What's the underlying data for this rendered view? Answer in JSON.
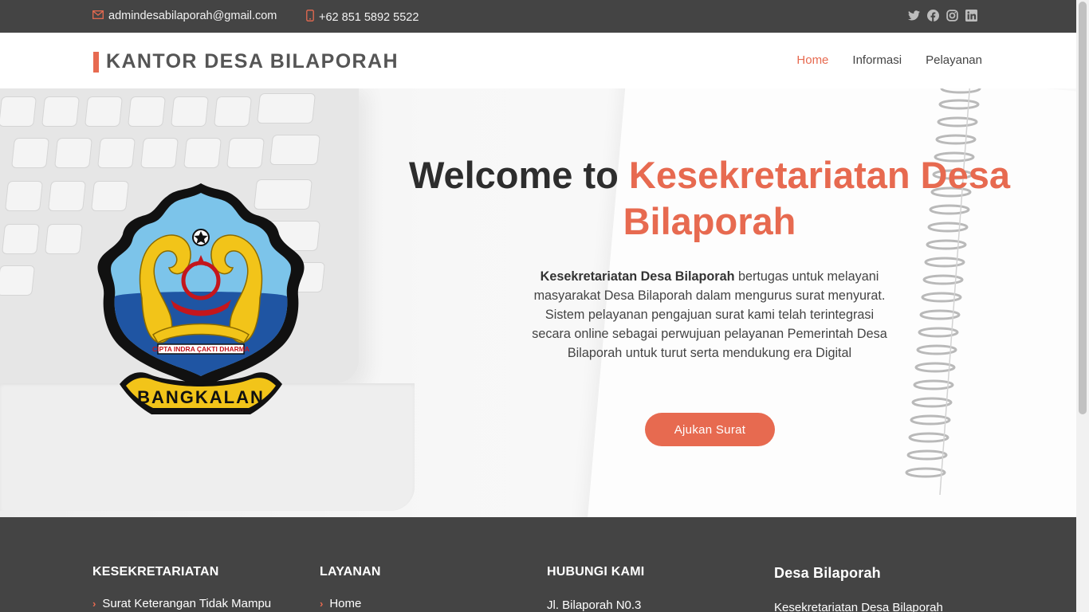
{
  "topbar": {
    "email": "admindesabilaporah@gmail.com",
    "phone": "+62 851 5892 5522",
    "social_icons": [
      "twitter-icon",
      "facebook-icon",
      "instagram-icon",
      "linkedin-icon"
    ]
  },
  "header": {
    "brand": "KANTOR DESA BILAPORAH",
    "nav": [
      "Home",
      "Informasi",
      "Pelayanan"
    ],
    "active_nav": "Home"
  },
  "hero": {
    "title_prefix": "Welcome to ",
    "title_highlight": "Kesekretariatan Desa Bilaporah",
    "desc_bold": "Kesekretariatan Desa Bilaporah",
    "desc_rest": " bertugas untuk melayani masyarakat Desa Bilaporah dalam mengurus surat menyurat. Sistem pelayanan pengajuan surat kami telah terintegrasi secara online sebagai perwujuan pelayanan Pemerintah Desa Bilaporah untuk turut serta mendukung era Digital",
    "cta": "Ajukan Surat",
    "emblem": {
      "ribbon": "CIPTA INDRA ÇAKTI DHARMA",
      "banner": "BANGKALAN"
    }
  },
  "footer": {
    "col1": {
      "title": "KESEKRETARIATAN",
      "items": [
        "Surat Keterangan Tidak Mampu"
      ]
    },
    "col2": {
      "title": "LAYANAN",
      "items": [
        "Home"
      ]
    },
    "col3": {
      "title": "HUBUNGI KAMI",
      "items": [
        "Jl. Bilaporah N0.3"
      ]
    },
    "col4": {
      "title": "Desa Bilaporah",
      "items": [
        "Kesekretariatan Desa Bilaporah"
      ]
    }
  },
  "colors": {
    "accent": "#e76a50",
    "dark": "#444444"
  }
}
